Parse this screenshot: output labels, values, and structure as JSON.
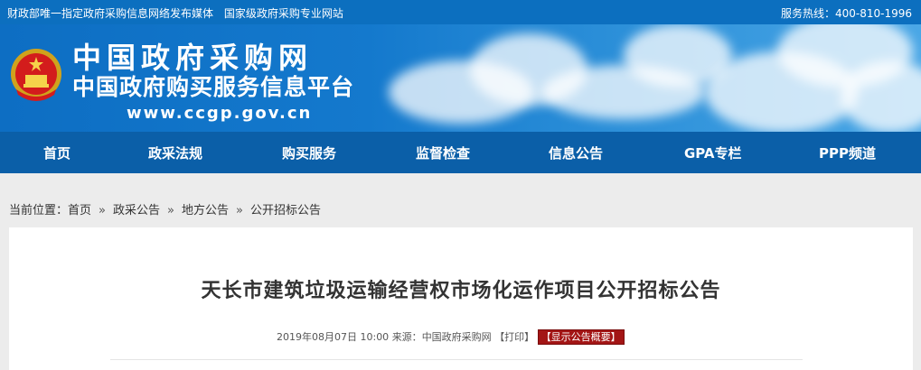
{
  "topbar": {
    "left_1": "财政部唯一指定政府采购信息网络发布媒体",
    "left_2": "国家级政府采购专业网站",
    "hotline_label": "服务热线：",
    "hotline_number": "400-810-1996"
  },
  "header": {
    "site_name": "中国政府采购网",
    "site_subtitle": "中国政府购买服务信息平台",
    "site_url": "www.ccgp.gov.cn"
  },
  "nav": {
    "items": [
      {
        "label": "首页"
      },
      {
        "label": "政采法规"
      },
      {
        "label": "购买服务"
      },
      {
        "label": "监督检查"
      },
      {
        "label": "信息公告"
      },
      {
        "label": "GPA专栏"
      },
      {
        "label": "PPP频道"
      }
    ]
  },
  "breadcrumb": {
    "prefix": "当前位置：",
    "items": [
      "首页",
      "政采公告",
      "地方公告",
      "公开招标公告"
    ],
    "separator": "»"
  },
  "article": {
    "title": "天长市建筑垃圾运输经营权市场化运作项目公开招标公告",
    "date": "2019年08月07日 10:00",
    "source_label": "来源：",
    "source": "中国政府采购网",
    "print_label": "【打印】",
    "show_summary_label": "【显示公告概要】"
  },
  "colors": {
    "topbar": "#0c6fbf",
    "nav": "#0b5fa8",
    "summary_button": "#a31515"
  }
}
